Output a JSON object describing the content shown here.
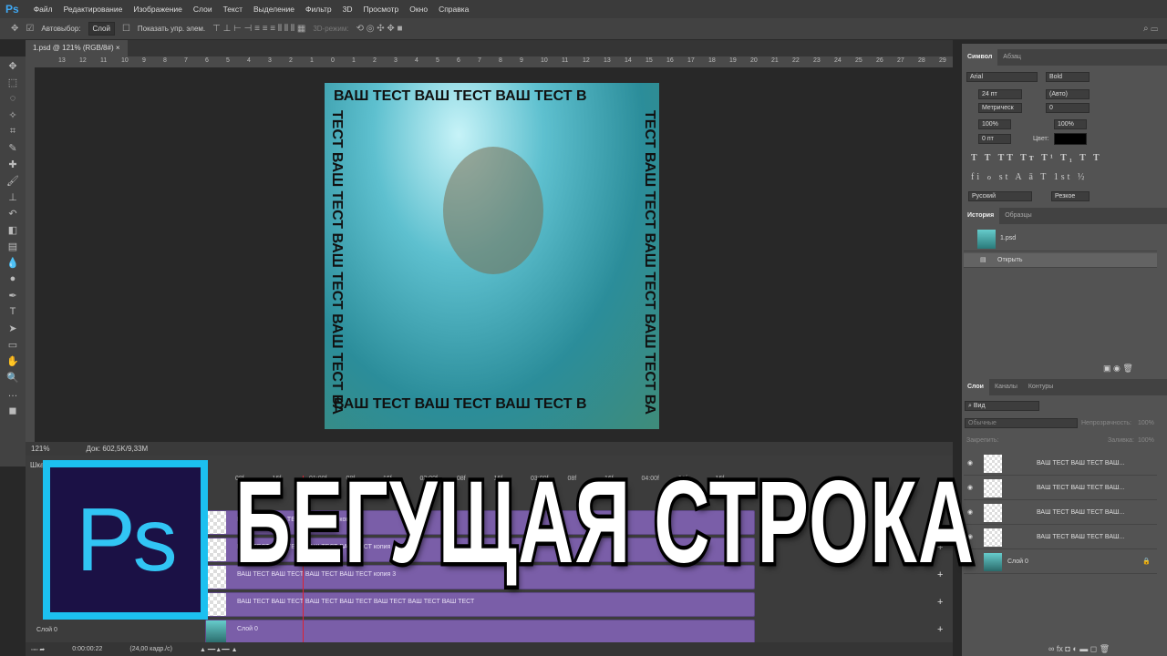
{
  "app": {
    "logo": "Ps"
  },
  "menu": [
    "Файл",
    "Редактирование",
    "Изображение",
    "Слои",
    "Текст",
    "Выделение",
    "Фильтр",
    "3D",
    "Просмотр",
    "Окно",
    "Справка"
  ],
  "options": {
    "autoselect_label": "Автовыбор:",
    "autoselect_value": "Слой",
    "show_controls": "Показать упр. элем.",
    "mode3d": "3D-режим:"
  },
  "doc_tab": "1.psd @ 121% (RGB/8#)",
  "ruler": [
    "13",
    "12",
    "11",
    "10",
    "9",
    "8",
    "7",
    "6",
    "5",
    "4",
    "3",
    "2",
    "1",
    "0",
    "1",
    "2",
    "3",
    "4",
    "5",
    "6",
    "7",
    "8",
    "9",
    "10",
    "11",
    "12",
    "13",
    "14",
    "15",
    "16",
    "17",
    "18",
    "19",
    "20",
    "21",
    "22",
    "23",
    "24",
    "25",
    "26",
    "27",
    "28",
    "29"
  ],
  "canvas_text": {
    "horizontal": "ВАШ ТЕСТ ВАШ ТЕСТ ВАШ ТЕСТ В",
    "vertical": "ТЕСТ ВАШ ТЕСТ ВАШ ТЕСТ ВАШ ТЕСТ ВА"
  },
  "status": {
    "zoom": "121%",
    "doc": "Док: 602,5K/9,33M"
  },
  "timeline": {
    "title": "Шка",
    "ticks": [
      "08f",
      "16f",
      "01:00f",
      "08f",
      "16f",
      "02:00f",
      "08f",
      "16f",
      "03:00f",
      "08f",
      "16f",
      "04:00f",
      "08f",
      "16f"
    ],
    "tracks": [
      "ВАШ ТЕСТ ВАШ ТЕСТ ВАШ ТЕСТ копия 2",
      "ВАШ ТЕСТ ВАШ ТЕСТ ВАШ ТЕСТ ВАШ ТЕСТ копия",
      "ВАШ ТЕСТ ВАШ ТЕСТ ВАШ ТЕСТ ВАШ ТЕСТ копия 3",
      "ВАШ ТЕСТ ВАШ ТЕСТ ВАШ ТЕСТ ВАШ ТЕСТ ВАШ ТЕСТ ВАШ ТЕСТ ВАШ ТЕСТ",
      "Слой 0"
    ],
    "layer_label": "Слой 0",
    "time": "0:00:00:22",
    "fps": "(24,00 кадр./с)"
  },
  "character": {
    "tabs": [
      "Символ",
      "Абзац"
    ],
    "font": "Arial",
    "style": "Bold",
    "size": "24 пт",
    "leading": "(Авто)",
    "kerning": "Метрическ",
    "tracking": "0",
    "vscale": "100%",
    "hscale": "100%",
    "baseline": "0 пт",
    "color_label": "Цвет:",
    "color": "#000000",
    "language": "Русский",
    "aa": "Резкое",
    "styles": "T T TT Tт T¹ T₁ T T",
    "opentype": "fi ℴ st A ā T 1st ½"
  },
  "history": {
    "tabs": [
      "История",
      "Образцы"
    ],
    "items": [
      "1.psd",
      "Открыть"
    ]
  },
  "layers": {
    "tabs": [
      "Слои",
      "Каналы",
      "Контуры"
    ],
    "filter": "Вид",
    "blend": "Обычные",
    "opacity_label": "Непрозрачность:",
    "opacity": "100%",
    "lock_label": "Закрепить:",
    "fill_label": "Заливка:",
    "fill": "100%",
    "rows": [
      "ВАШ ТЕСТ ВАШ ТЕСТ ВАШ...",
      "ВАШ ТЕСТ ВАШ ТЕСТ ВАШ...",
      "ВАШ ТЕСТ ВАШ ТЕСТ ВАШ...",
      "ВАШ ТЕСТ ВАШ ТЕСТ ВАШ...",
      "Слой 0"
    ]
  },
  "overlay": {
    "logo": "Ps",
    "title": "БЕГУЩАЯ СТРОКА"
  }
}
